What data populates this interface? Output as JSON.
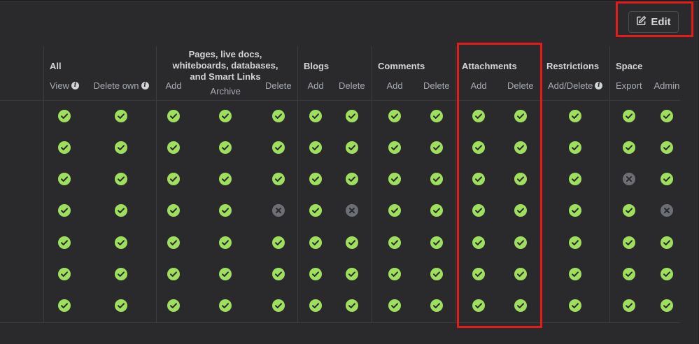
{
  "toolbar": {
    "edit_label": "Edit",
    "edit_icon": "edit-icon"
  },
  "groups": {
    "all": "All",
    "pages_line1": "Pages, live docs,",
    "pages_line2": "whiteboards, databases,",
    "pages_line3": "and Smart Links",
    "blogs": "Blogs",
    "comments": "Comments",
    "attachments": "Attachments",
    "restrictions": "Restrictions",
    "space": "Space"
  },
  "columns": [
    {
      "key": "all_view",
      "label": "View",
      "info": true
    },
    {
      "key": "all_delete_own",
      "label": "Delete own",
      "info": true
    },
    {
      "key": "pages_add",
      "label": "Add"
    },
    {
      "key": "pages_archive",
      "label": "Archive"
    },
    {
      "key": "pages_delete",
      "label": "Delete"
    },
    {
      "key": "blogs_add",
      "label": "Add"
    },
    {
      "key": "blogs_delete",
      "label": "Delete"
    },
    {
      "key": "comments_add",
      "label": "Add"
    },
    {
      "key": "comments_delete",
      "label": "Delete"
    },
    {
      "key": "attachments_add",
      "label": "Add"
    },
    {
      "key": "attachments_delete",
      "label": "Delete"
    },
    {
      "key": "restrictions_add_delete",
      "label": "Add/Delete",
      "info": true
    },
    {
      "key": "space_export",
      "label": "Export"
    },
    {
      "key": "space_admin",
      "label": "Admin"
    }
  ],
  "rows": [
    [
      true,
      true,
      true,
      true,
      true,
      true,
      true,
      true,
      true,
      true,
      true,
      true,
      true,
      true
    ],
    [
      true,
      true,
      true,
      true,
      true,
      true,
      true,
      true,
      true,
      true,
      true,
      true,
      true,
      true
    ],
    [
      true,
      true,
      true,
      true,
      true,
      true,
      true,
      true,
      true,
      true,
      true,
      true,
      false,
      true
    ],
    [
      true,
      true,
      true,
      true,
      false,
      true,
      false,
      true,
      true,
      true,
      true,
      true,
      true,
      false
    ],
    [
      true,
      true,
      true,
      true,
      true,
      true,
      true,
      true,
      true,
      true,
      true,
      true,
      true,
      true
    ],
    [
      true,
      true,
      true,
      true,
      true,
      true,
      true,
      true,
      true,
      true,
      true,
      true,
      true,
      true
    ],
    [
      true,
      true,
      true,
      true,
      true,
      true,
      true,
      true,
      true,
      true,
      true,
      true,
      true,
      true
    ]
  ],
  "colors": {
    "granted": "#9fdf5e",
    "denied": "#6e6f74",
    "highlight": "#e31b1b"
  }
}
